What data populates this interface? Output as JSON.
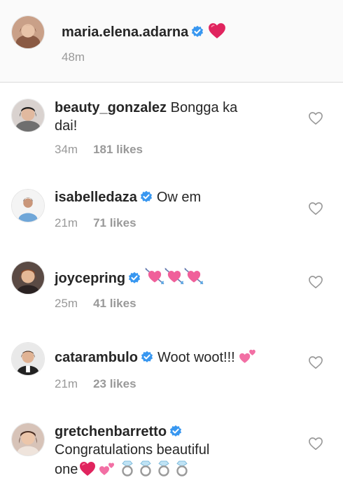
{
  "caption": {
    "username": "maria.elena.adarna",
    "time": "48m"
  },
  "comments": [
    {
      "username": "beauty_gonzalez",
      "text_line1": "Bongga ka",
      "text_line2": "dai!",
      "time": "34m",
      "likes": "181 likes"
    },
    {
      "username": "isabelledaza",
      "text": "Ow em",
      "time": "21m",
      "likes": "71 likes"
    },
    {
      "username": "joycepring",
      "time": "25m",
      "likes": "41 likes"
    },
    {
      "username": "catarambulo",
      "text": "Woot woot!!!",
      "time": "21m",
      "likes": "23 likes"
    },
    {
      "username": "gretchenbarretto",
      "text_line1": "Congratulations beautiful",
      "text_line2": "one"
    }
  ],
  "colors": {
    "verified": "#3897f0",
    "heart_emoji": "#e0245e",
    "meta_text": "#999999"
  },
  "icons": [
    "verified-badge-icon",
    "red-heart-emoji",
    "heart-with-arrow-emoji",
    "two-hearts-emoji",
    "ring-emoji",
    "like-heart-icon"
  ]
}
